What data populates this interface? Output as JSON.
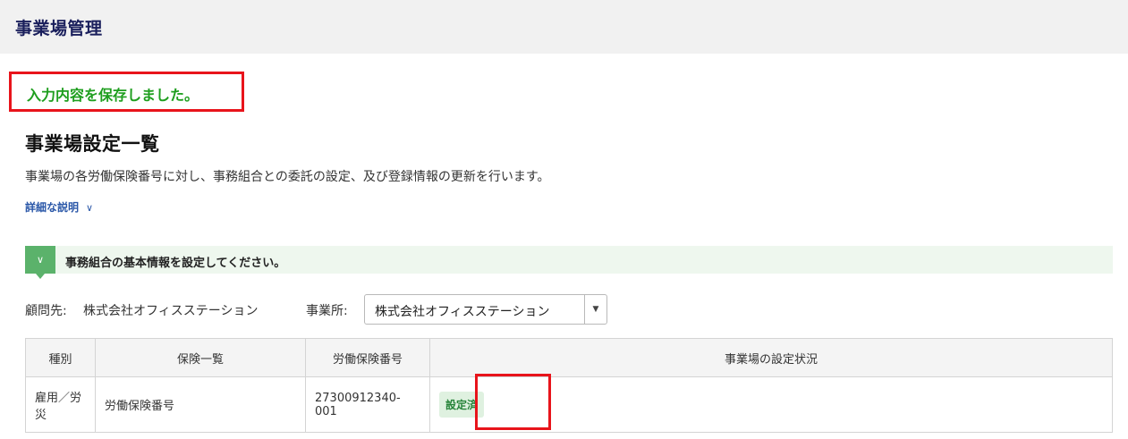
{
  "header": {
    "title": "事業場管理"
  },
  "save_message": "入力内容を保存しました。",
  "page": {
    "title": "事業場設定一覧",
    "description": "事業場の各労働保険番号に対し、事務組合との委託の設定、及び登録情報の更新を行います。",
    "detail_link": "詳細な説明",
    "detail_link_icon": "chevron-down-icon"
  },
  "notice": {
    "icon": "chevron-down-icon",
    "text": "事務組合の基本情報を設定してください。"
  },
  "filter": {
    "client_label": "顧問先:",
    "client_value": "株式会社オフィスステーション",
    "office_label": "事業所:",
    "office_selected": "株式会社オフィスステーション"
  },
  "table": {
    "headers": [
      "種別",
      "保険一覧",
      "労働保険番号",
      "事業場の設定状況"
    ],
    "rows": [
      {
        "type": "雇用／労災",
        "insurance": "労働保険番号",
        "number": "27300912340-001",
        "status": "設定済"
      }
    ]
  },
  "colors": {
    "header_title": "#1a1f5c",
    "save_message": "#1e9e1e",
    "highlight_border": "#e8141b",
    "notice_icon_bg": "#5bb26b",
    "status_badge_bg": "#dff1e0",
    "link": "#2a57a8"
  }
}
